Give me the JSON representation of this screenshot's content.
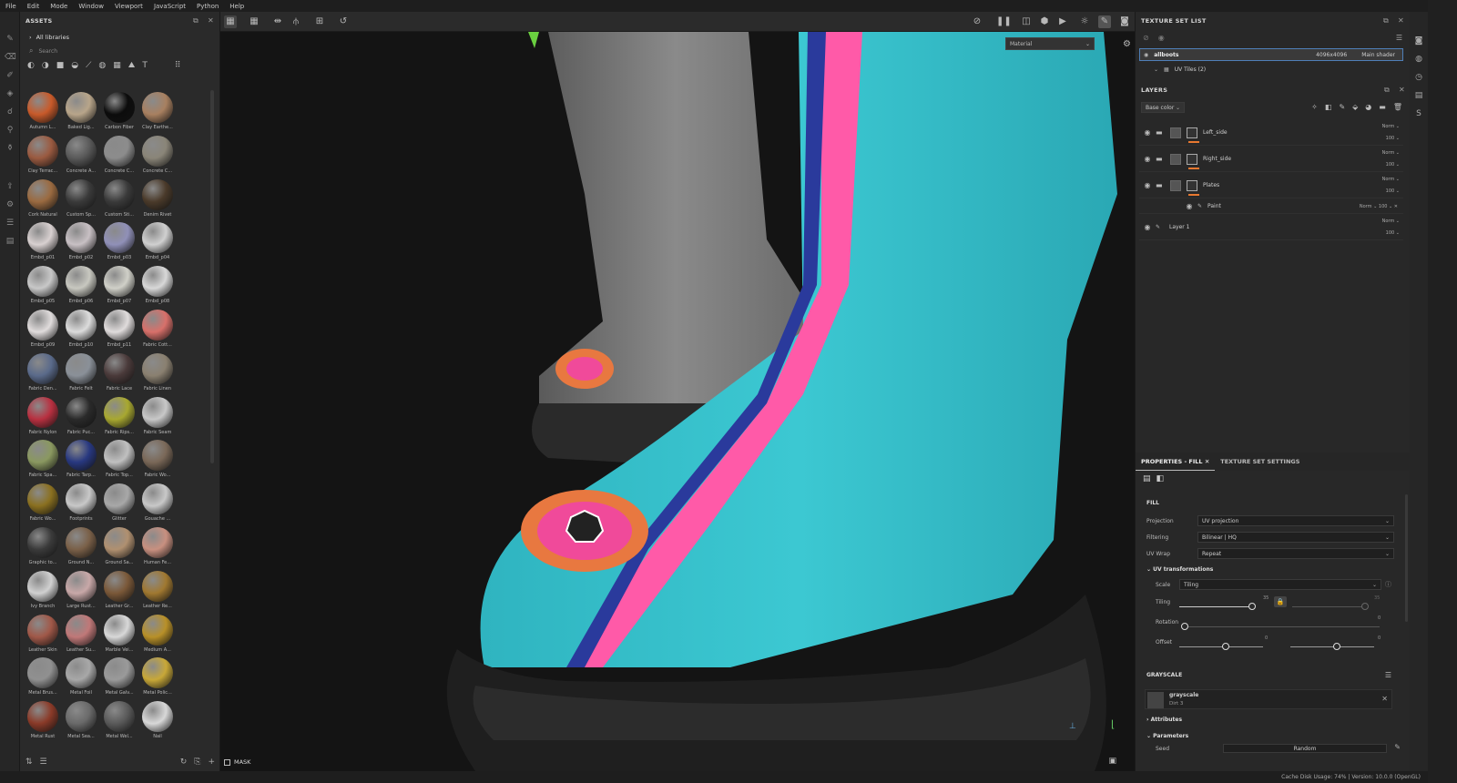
{
  "menu": [
    "File",
    "Edit",
    "Mode",
    "Window",
    "Viewport",
    "JavaScript",
    "Python",
    "Help"
  ],
  "assets": {
    "title": "ASSETS",
    "libraries": "All libraries",
    "search_placeholder": "Search",
    "items": [
      {
        "label": "Autumn L...",
        "color": "#c85a2a"
      },
      {
        "label": "Baked Lig...",
        "color": "#b8a58a"
      },
      {
        "label": "Carbon Fiber",
        "color": "#0c0c0c"
      },
      {
        "label": "Clay Earthe...",
        "color": "#a88060"
      },
      {
        "label": "Clay Terrac...",
        "color": "#9a5a40"
      },
      {
        "label": "Concrete A...",
        "color": "#5a5a5a"
      },
      {
        "label": "Concrete C...",
        "color": "#8c8c8c"
      },
      {
        "label": "Concrete C...",
        "color": "#8a8578"
      },
      {
        "label": "Cork Natural",
        "color": "#9a6a40"
      },
      {
        "label": "Custom Sp...",
        "color": "#3a3a3a"
      },
      {
        "label": "Custom Sti...",
        "color": "#3a3a3a"
      },
      {
        "label": "Denim Rivet",
        "color": "#4a3a2a"
      },
      {
        "label": "Embd_p01",
        "color": "#d8d0d0"
      },
      {
        "label": "Embd_p02",
        "color": "#c8c0c4"
      },
      {
        "label": "Embd_p03",
        "color": "#9090b8"
      },
      {
        "label": "Embd_p04",
        "color": "#d0d0d0"
      },
      {
        "label": "Embd_p05",
        "color": "#c8c8c8"
      },
      {
        "label": "Embd_p06",
        "color": "#c8c8c0"
      },
      {
        "label": "Embd_p07",
        "color": "#d0d0c8"
      },
      {
        "label": "Embd_p08",
        "color": "#d8d8d8"
      },
      {
        "label": "Embd_p09",
        "color": "#e0dcdc"
      },
      {
        "label": "Embd_p10",
        "color": "#dcdcdc"
      },
      {
        "label": "Embd_p11",
        "color": "#e0dcdc"
      },
      {
        "label": "Fabric Cott...",
        "color": "#d8706a"
      },
      {
        "label": "Fabric Den...",
        "color": "#5a6a8a"
      },
      {
        "label": "Fabric Felt",
        "color": "#8a9098"
      },
      {
        "label": "Fabric Lace",
        "color": "#4a3a3a"
      },
      {
        "label": "Fabric Linen",
        "color": "#8a8070"
      },
      {
        "label": "Fabric Nylon",
        "color": "#b83040"
      },
      {
        "label": "Fabric Puc...",
        "color": "#2a2a2a"
      },
      {
        "label": "Fabric Rips...",
        "color": "#a8a830"
      },
      {
        "label": "Fabric Seam",
        "color": "#c8c8c8"
      },
      {
        "label": "Fabric Spa...",
        "color": "#8a9860"
      },
      {
        "label": "Fabric Tarp...",
        "color": "#283880"
      },
      {
        "label": "Fabric Top...",
        "color": "#c0c0c0"
      },
      {
        "label": "Fabric Wo...",
        "color": "#7a6858"
      },
      {
        "label": "Fabric Wo...",
        "color": "#8a7020"
      },
      {
        "label": "Footprints",
        "color": "#c8c8c8"
      },
      {
        "label": "Glitter",
        "color": "#a8a8a8"
      },
      {
        "label": "Gouache ...",
        "color": "#c8c8c8"
      },
      {
        "label": "Graphic to...",
        "color": "#3a3a3a"
      },
      {
        "label": "Ground N...",
        "color": "#7a6048"
      },
      {
        "label": "Ground Sa...",
        "color": "#b09070"
      },
      {
        "label": "Human Fe...",
        "color": "#c89080"
      },
      {
        "label": "Ivy Branch",
        "color": "#d0d0d0"
      },
      {
        "label": "Large Rust...",
        "color": "#c8a8a8"
      },
      {
        "label": "Leather Gr...",
        "color": "#7a5838"
      },
      {
        "label": "Leather Re...",
        "color": "#a07830"
      },
      {
        "label": "Leather Skin",
        "color": "#a05848"
      },
      {
        "label": "Leather Su...",
        "color": "#c07878"
      },
      {
        "label": "Marble Vei...",
        "color": "#d8d8d8"
      },
      {
        "label": "Medium A...",
        "color": "#b89028"
      },
      {
        "label": "Metal Brus...",
        "color": "#909090"
      },
      {
        "label": "Metal Foil",
        "color": "#a8a8a8"
      },
      {
        "label": "Metal Galv...",
        "color": "#9a9a9a"
      },
      {
        "label": "Metal Polic...",
        "color": "#c8a838"
      },
      {
        "label": "Metal Rust",
        "color": "#8a3a28"
      },
      {
        "label": "Metal Sea...",
        "color": "#6a6a6a"
      },
      {
        "label": "Metal Wel...",
        "color": "#5a5a5a"
      },
      {
        "label": "Nail",
        "color": "#d8d8d8"
      }
    ]
  },
  "viewport": {
    "material_dropdown": "Material",
    "mask_label": "MASK"
  },
  "texture_set_list": {
    "title": "TEXTURE SET LIST",
    "set_name": "allboots",
    "resolution": "4096x4096",
    "shader": "Main shader",
    "uv_tiles": "UV Tiles (2)"
  },
  "layers": {
    "title": "LAYERS",
    "channel": "Base color",
    "items": [
      {
        "name": "Left_side",
        "blend": "Norm",
        "opacity": "100"
      },
      {
        "name": "Right_side",
        "blend": "Norm",
        "opacity": "100"
      },
      {
        "name": "Plates",
        "blend": "Norm",
        "opacity": "100"
      },
      {
        "name": "Paint",
        "blend": "Norm",
        "opacity": "100"
      },
      {
        "name": "Layer 1",
        "blend": "Norm",
        "opacity": "100"
      }
    ]
  },
  "properties": {
    "tab_fill": "PROPERTIES - FILL",
    "tab_tss": "TEXTURE SET SETTINGS",
    "fill_header": "FILL",
    "projection_label": "Projection",
    "projection_value": "UV projection",
    "filtering_label": "Filtering",
    "filtering_value": "Bilinear | HQ",
    "uvwrap_label": "UV Wrap",
    "uvwrap_value": "Repeat",
    "uvtrans_header": "UV transformations",
    "scale_label": "Scale",
    "scale_value": "Tiling",
    "tiling_label": "Tiling",
    "tiling_value": "35",
    "tiling_value2": "35",
    "rotation_label": "Rotation",
    "rotation_value": "0",
    "offset_label": "Offset",
    "offset_value": "0",
    "offset_value2": "0",
    "grayscale_header": "GRAYSCALE",
    "gs_name": "grayscale",
    "gs_sub": "Dirt 3",
    "attributes_header": "Attributes",
    "parameters_header": "Parameters",
    "seed_label": "Seed",
    "seed_value": "Random"
  },
  "status": "Cache Disk Usage:  74% | Version: 10.0.0 (OpenGL)"
}
